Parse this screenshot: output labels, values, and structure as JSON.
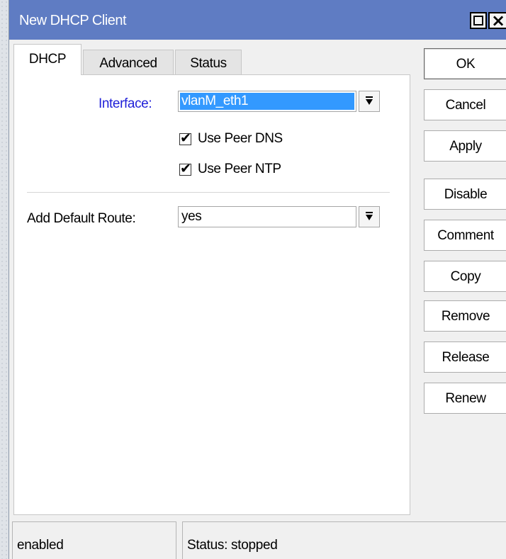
{
  "window": {
    "title": "New DHCP Client"
  },
  "tabs": [
    {
      "label": "DHCP",
      "active": true
    },
    {
      "label": "Advanced",
      "active": false
    },
    {
      "label": "Status",
      "active": false
    }
  ],
  "form": {
    "interface_label": "Interface:",
    "interface_value": "vlanM_eth1",
    "use_peer_dns_label": "Use Peer DNS",
    "use_peer_dns_checked": true,
    "use_peer_ntp_label": "Use Peer NTP",
    "use_peer_ntp_checked": true,
    "default_route_label": "Add Default Route:",
    "default_route_value": "yes"
  },
  "buttons": {
    "ok": "OK",
    "cancel": "Cancel",
    "apply": "Apply",
    "disable": "Disable",
    "comment": "Comment",
    "copy": "Copy",
    "remove": "Remove",
    "release": "Release",
    "renew": "Renew"
  },
  "status": {
    "state": "enabled",
    "text": "Status: stopped"
  },
  "icons": {
    "maximize": "maximize-icon",
    "close": "close-icon",
    "dropdown": "dropdown-arrow-icon",
    "check": "check-icon"
  },
  "colors": {
    "titlebar": "#5f7cc3",
    "interface_label": "#1f1fd8",
    "selection": "#3399ff"
  }
}
